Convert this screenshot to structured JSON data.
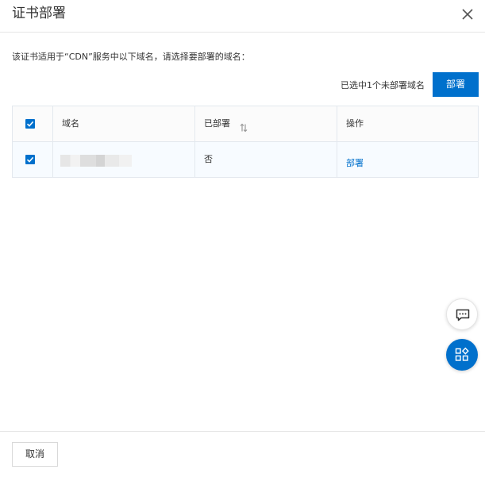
{
  "dialog": {
    "title": "证书部署",
    "close_icon": "close-icon"
  },
  "description": "该证书适用于“CDN”服务中以下域名，请选择要部署的域名：",
  "selection": {
    "info": "已选中1个未部署域名",
    "deploy_label": "部署"
  },
  "table": {
    "columns": {
      "domain": "域名",
      "deployed": "已部署",
      "action": "操作"
    },
    "header_checked": true,
    "rows": [
      {
        "checked": true,
        "domain": "",
        "deployed": "否",
        "action": "部署"
      }
    ]
  },
  "floating": {
    "chat_icon": "chat-icon",
    "apps_icon": "apps-icon"
  },
  "footer": {
    "cancel_label": "取消"
  },
  "colors": {
    "accent": "#0070cc",
    "row_highlight": "#f7fbff",
    "border": "#e3e8ee"
  }
}
